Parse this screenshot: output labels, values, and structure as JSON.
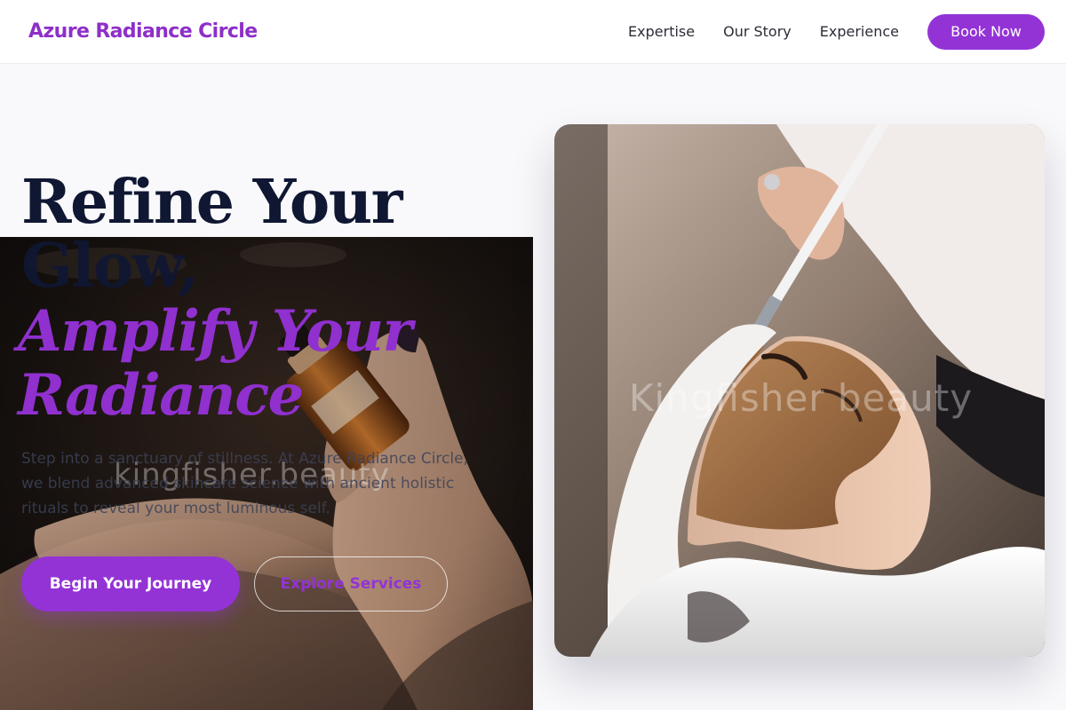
{
  "brand": {
    "name": "Azure Radiance Circle",
    "color": "#8e2fc8"
  },
  "nav": {
    "links": [
      "Expertise",
      "Our Story",
      "Experience"
    ],
    "cta": "Book Now"
  },
  "hero": {
    "title_line1": "Refine Your",
    "title_line2": "Glow,",
    "accent_line1": "Amplify Your",
    "accent_line2": "Radiance",
    "description": "Step into a sanctuary of stillness. At Azure Radiance Circle, we blend advanced skincare science with ancient holistic rituals to reveal your most luminous self.",
    "primary_cta": "Begin Your Journey",
    "secondary_cta": "Explore Services"
  },
  "images": {
    "left_watermark": "kingfisher.beauty",
    "right_watermark": "Kingfisher beauty"
  },
  "colors": {
    "accent": "#9333d6",
    "heading": "#0f1733",
    "text": "#3c4258"
  }
}
